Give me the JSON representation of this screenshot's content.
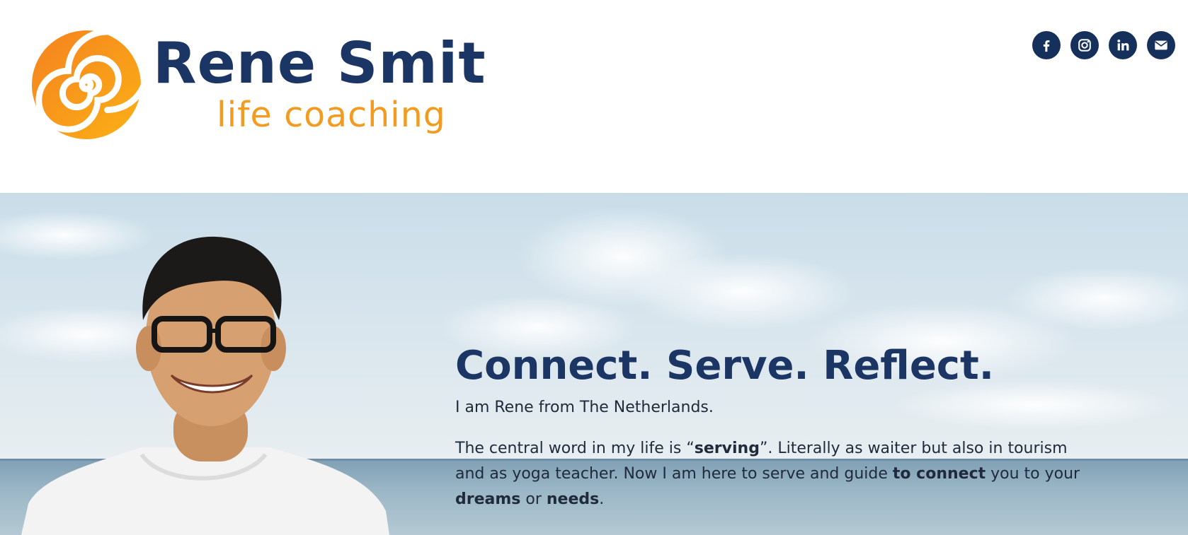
{
  "header": {
    "logo": {
      "name": "Rene Smit",
      "tagline": "life coaching",
      "icon": "orange-spiral-icon",
      "colors": {
        "name": "#1b3664",
        "tagline": "#f29b20",
        "spiral": "#f7941d"
      }
    },
    "social": [
      {
        "name": "facebook",
        "icon": "facebook-icon"
      },
      {
        "name": "instagram",
        "icon": "instagram-icon"
      },
      {
        "name": "linkedin",
        "icon": "linkedin-icon"
      },
      {
        "name": "email",
        "icon": "envelope-icon"
      }
    ],
    "social_color": "#16305c"
  },
  "hero": {
    "background": "beach-sky-sea-photo",
    "portrait": "smiling-man-with-glasses-photo",
    "title": "Connect. Serve. Reflect.",
    "intro": "I am Rene from The Netherlands.",
    "body": {
      "p1": "The central word in my life is “",
      "b1": "serving",
      "p2": "”. Literally as waiter but also in tourism and as yoga teacher. Now I am here to serve and guide ",
      "b2": "to connect",
      "p3": " you to your ",
      "b3": "dreams",
      "p4": " or ",
      "b4": "needs",
      "p5": "."
    }
  }
}
